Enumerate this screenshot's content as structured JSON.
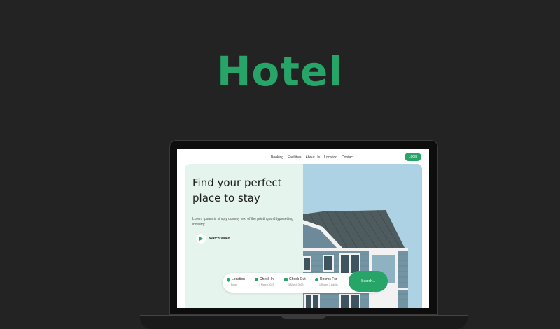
{
  "title": "Hotel",
  "nav": {
    "links": [
      "Booking",
      "Facilities",
      "About Us",
      "Location",
      "Contact"
    ],
    "login": "Login"
  },
  "hero": {
    "headline_line1": "Find your perfect",
    "headline_line2": "place to stay",
    "subtext": "Lorem Ipsum is simply dummy text of the printing and typesetting industry.",
    "watch_video": "Watch Video"
  },
  "search": {
    "location_label": "Location",
    "location_value": "Egypt",
    "checkin_label": "Check In",
    "checkin_value": "1 March 2023",
    "checkout_label": "Check Out",
    "checkout_value": "3 March 2023",
    "rooms_label": "Rooms For",
    "rooms_value": "1 Room, 2 Adults",
    "button": "Search..."
  },
  "colors": {
    "accent": "#27a468",
    "background": "#232323",
    "hero_bg": "#e5f4ec"
  }
}
